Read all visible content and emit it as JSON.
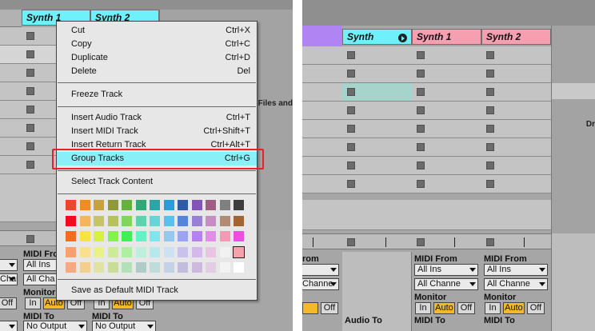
{
  "left": {
    "tracks": [
      {
        "name": "Synth 1",
        "color": "#6ff1fb"
      },
      {
        "name": "Synth 2",
        "color": "#6ff1fb"
      }
    ],
    "io": {
      "midi_from": "MIDI From",
      "all_ins": "All Ins",
      "all_channels": "All Cha",
      "monitor": "Monitor",
      "in": "In",
      "auto": "Auto",
      "off": "Off",
      "midi_to": "MIDI To",
      "no_output": "No Output",
      "left_all_ins": "All Ins",
      "left_chann": "Channe",
      "left_off": "Off"
    },
    "bg_text": "Files and"
  },
  "menu": {
    "items": [
      {
        "label": "Cut",
        "shortcut": "Ctrl+X"
      },
      {
        "label": "Copy",
        "shortcut": "Ctrl+C"
      },
      {
        "label": "Duplicate",
        "shortcut": "Ctrl+D"
      },
      {
        "label": "Delete",
        "shortcut": "Del"
      },
      {
        "label": "Freeze Track",
        "shortcut": ""
      },
      {
        "label": "Insert Audio Track",
        "shortcut": "Ctrl+T"
      },
      {
        "label": "Insert MIDI Track",
        "shortcut": "Ctrl+Shift+T"
      },
      {
        "label": "Insert Return Track",
        "shortcut": "Ctrl+Alt+T"
      },
      {
        "label": "Group Tracks",
        "shortcut": "Ctrl+G"
      },
      {
        "label": "Select Track Content",
        "shortcut": ""
      },
      {
        "label": "Save as Default MIDI Track",
        "shortcut": ""
      }
    ],
    "palette": [
      [
        "#f0452d",
        "#f18b24",
        "#c8a13a",
        "#8e9a33",
        "#64b23d",
        "#30a976",
        "#27a7a8",
        "#2b9cd9",
        "#2f5aa8",
        "#8154b8",
        "#a05e85",
        "#7f7f7f",
        "#3d3d3d"
      ],
      [
        "#f30c1f",
        "#f5b55e",
        "#c7c367",
        "#b6c25a",
        "#7fd65b",
        "#5cd3ad",
        "#67d4d7",
        "#5ac0f0",
        "#5585d8",
        "#9a7fd9",
        "#c68dc3",
        "#b38a74",
        "#a26335"
      ],
      [
        "#f46c22",
        "#f7e344",
        "#d8f040",
        "#83f34b",
        "#40ef58",
        "#61f3c5",
        "#80e5ee",
        "#95c8ef",
        "#9aa4f0",
        "#b581ef",
        "#e38de8",
        "#f09ab5",
        "#ec4fdb"
      ],
      [
        "#f9a070",
        "#f9e08f",
        "#e8f285",
        "#cdea96",
        "#aef0a1",
        "#bfeedd",
        "#b5e9ee",
        "#cde1f5",
        "#c8c3ed",
        "#d5b9eb",
        "#e9c4e3",
        "#f1f1f1",
        "#f4a3ad"
      ],
      [
        "#f5a982",
        "#f2cf91",
        "#dfe3a4",
        "#c8de96",
        "#b4e0b8",
        "#aeccc5",
        "#bfdcdd",
        "#c3d2e6",
        "#c1bedd",
        "#cdbadd",
        "#e2cde3",
        "#f3f3f3",
        "#ffffff"
      ]
    ]
  },
  "right": {
    "tracks": [
      {
        "name": "Synth",
        "color": "#6ff1fb"
      },
      {
        "name": "Synth 1",
        "color": "#f59fb0"
      },
      {
        "name": "Synth 2",
        "color": "#f59fb0"
      }
    ],
    "io": {
      "midi_from": "MIDI From",
      "all_ins": "All Ins",
      "all_channels": "All Channe",
      "monitor": "Monitor",
      "in": "In",
      "auto": "Auto",
      "off": "Off",
      "midi_to": "MIDI To",
      "audio_to": "Audio To",
      "left_from": "rom",
      "left_chann": "Channe",
      "left_off": "Off"
    },
    "bg_text": "Dr"
  }
}
